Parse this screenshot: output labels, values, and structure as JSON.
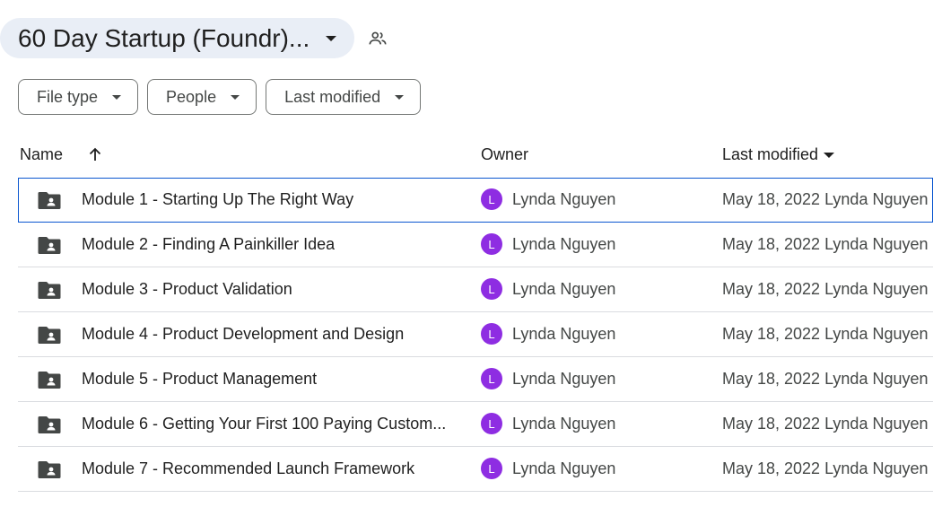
{
  "header": {
    "folder_title": "60 Day Startup (Foundr)..."
  },
  "filters": [
    {
      "label": "File type"
    },
    {
      "label": "People"
    },
    {
      "label": "Last modified"
    }
  ],
  "table": {
    "columns": {
      "name": "Name",
      "owner": "Owner",
      "modified": "Last modified"
    },
    "rows": [
      {
        "name": "Module 1 - Starting Up The Right Way",
        "owner_initial": "L",
        "owner": "Lynda Nguyen",
        "modified": "May 18, 2022 Lynda Nguyen"
      },
      {
        "name": "Module 2 - Finding A Painkiller Idea",
        "owner_initial": "L",
        "owner": "Lynda Nguyen",
        "modified": "May 18, 2022 Lynda Nguyen"
      },
      {
        "name": "Module 3 - Product Validation",
        "owner_initial": "L",
        "owner": "Lynda Nguyen",
        "modified": "May 18, 2022 Lynda Nguyen"
      },
      {
        "name": "Module 4 - Product Development and Design",
        "owner_initial": "L",
        "owner": "Lynda Nguyen",
        "modified": "May 18, 2022 Lynda Nguyen"
      },
      {
        "name": "Module 5 - Product Management",
        "owner_initial": "L",
        "owner": "Lynda Nguyen",
        "modified": "May 18, 2022 Lynda Nguyen"
      },
      {
        "name": "Module 6 - Getting Your First 100 Paying Custom...",
        "owner_initial": "L",
        "owner": "Lynda Nguyen",
        "modified": "May 18, 2022 Lynda Nguyen"
      },
      {
        "name": "Module 7 - Recommended Launch Framework",
        "owner_initial": "L",
        "owner": "Lynda Nguyen",
        "modified": "May 18, 2022 Lynda Nguyen"
      }
    ]
  },
  "colors": {
    "avatar": "#8e2de2",
    "selection_outline": "#0b57d0",
    "title_chip_bg": "#e9eef6"
  },
  "icons": {
    "title_dropdown": "chevron-down-icon",
    "shared": "people-icon",
    "sort": "arrow-up-icon",
    "folder": "shared-folder-icon"
  }
}
